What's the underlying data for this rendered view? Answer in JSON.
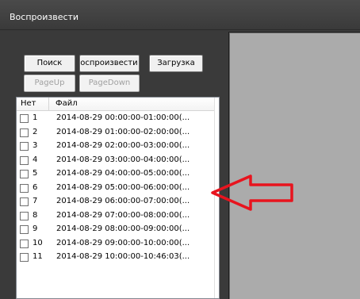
{
  "window": {
    "title": "Воспроизвести"
  },
  "toolbar": {
    "search_label": "Поиск",
    "play_label": "Воспроизвести",
    "download_label": "Загрузка",
    "page_up_label": "PageUp",
    "page_down_label": "PageDown"
  },
  "list": {
    "columns": {
      "num": "Нет",
      "file": "Файл"
    },
    "rows": [
      {
        "num": "1",
        "file": "2014-08-29 00:00:00-01:00:00(...",
        "checked": false
      },
      {
        "num": "2",
        "file": "2014-08-29 01:00:00-02:00:00(...",
        "checked": false
      },
      {
        "num": "3",
        "file": "2014-08-29 02:00:00-03:00:00(...",
        "checked": false
      },
      {
        "num": "4",
        "file": "2014-08-29 03:00:00-04:00:00(...",
        "checked": false
      },
      {
        "num": "5",
        "file": "2014-08-29 04:00:00-05:00:00(...",
        "checked": false
      },
      {
        "num": "6",
        "file": "2014-08-29 05:00:00-06:00:00(...",
        "checked": false
      },
      {
        "num": "7",
        "file": "2014-08-29 06:00:00-07:00:00(...",
        "checked": false
      },
      {
        "num": "8",
        "file": "2014-08-29 07:00:00-08:00:00(...",
        "checked": false
      },
      {
        "num": "9",
        "file": "2014-08-29 08:00:00-09:00:00(...",
        "checked": false
      },
      {
        "num": "10",
        "file": "2014-08-29 09:00:00-10:00:00(...",
        "checked": false
      },
      {
        "num": "11",
        "file": "2014-08-29 10:00:00-10:46:03(...",
        "checked": false
      }
    ]
  },
  "annotation": {
    "icon": "red-arrow-icon",
    "color": "#e8141e",
    "points_to_row": "5"
  },
  "colors": {
    "window_bg": "#3c3c3c",
    "video_bg": "#ababab",
    "list_bg": "#ffffff"
  }
}
